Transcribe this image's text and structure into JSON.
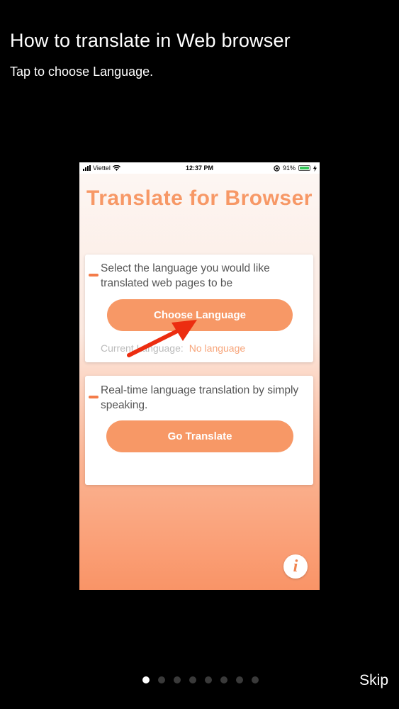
{
  "header": {
    "title": "How to translate in Web browser",
    "subtitle": "Tap to choose Language."
  },
  "phone": {
    "statusbar": {
      "carrier": "Viettel",
      "time": "12:37 PM",
      "battery": "91%",
      "battery_level": 0.91
    },
    "app_title": "Translate for Browser",
    "card1": {
      "description": "Select the language you would like translated web pages to be",
      "button": "Choose Language",
      "current_label": "Current Language:",
      "current_value": "No language"
    },
    "card2": {
      "description": "Real-time language translation by simply speaking.",
      "button": "Go Translate"
    },
    "info_icon": "info-icon",
    "accent": "#f79866"
  },
  "pager": {
    "count": 8,
    "active_index": 0,
    "skip_label": "Skip"
  }
}
